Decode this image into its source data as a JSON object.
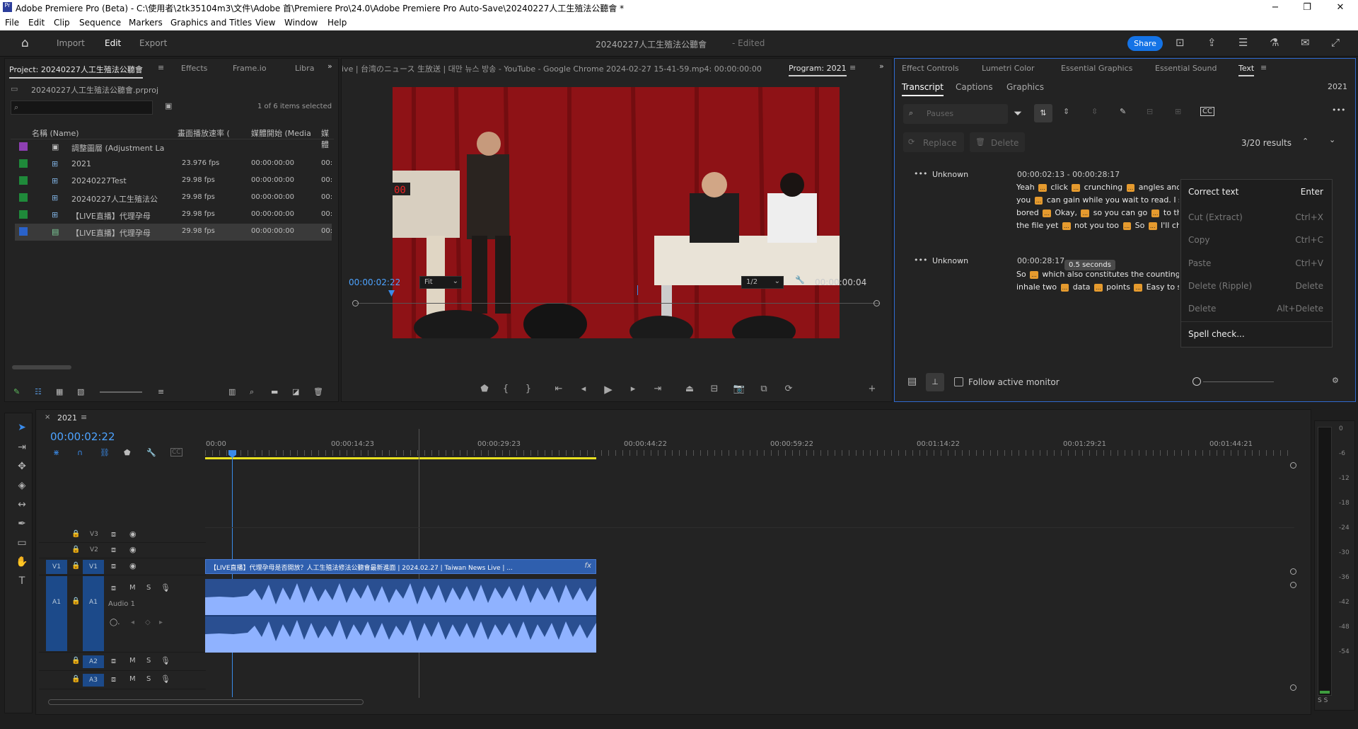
{
  "window": {
    "title": "Adobe Premiere Pro (Beta) - C:\\使用者\\2tk35104m3\\文件\\Adobe 首\\Premiere Pro\\24.0\\Adobe Premiere Pro Auto-Save\\20240227人工生殖法公聽會 *",
    "min": "−",
    "max": "❐",
    "close": "✕"
  },
  "menu": [
    "File",
    "Edit",
    "Clip",
    "Sequence",
    "Markers",
    "Graphics and Titles",
    "View",
    "Window",
    "Help"
  ],
  "appbar": {
    "workspaces": [
      "Import",
      "Edit",
      "Export"
    ],
    "active_workspace": "Edit",
    "project_title": "20240227人工生殖法公聽會",
    "edited": "- Edited",
    "share": "Share"
  },
  "project_panel": {
    "tabs": [
      "Project: 20240227人工生殖法公聽會",
      "Effects",
      "Frame.io",
      "Libra"
    ],
    "file": "20240227人工生殖法公聽會.prproj",
    "selection": "1 of 6 items selected",
    "columns": [
      "名稱 (Name)",
      "畫面播放速率 (",
      "媒體開始 (Media",
      "媒體"
    ],
    "rows": [
      {
        "name": "調整圖層 (Adjustment La",
        "fps": "",
        "start": "",
        "end": "",
        "color": "#8e3fb3"
      },
      {
        "name": "2021",
        "fps": "23.976 fps",
        "start": "00:00:00:00",
        "end": "00:",
        "color": "#1f8a3a"
      },
      {
        "name": "20240227Test",
        "fps": "29.98 fps",
        "start": "00:00:00:00",
        "end": "00:",
        "color": "#1f8a3a"
      },
      {
        "name": "20240227人工生殖法公",
        "fps": "29.98 fps",
        "start": "00:00:00:00",
        "end": "00:",
        "color": "#1f8a3a"
      },
      {
        "name": "【LIVE直播】代理孕母",
        "fps": "29.98 fps",
        "start": "00:00:00:00",
        "end": "00:",
        "color": "#1f8a3a"
      },
      {
        "name": "【LIVE直播】代理孕母",
        "fps": "29.98 fps",
        "start": "00:00:00:00",
        "end": "00:",
        "color": "#2a62c9"
      }
    ]
  },
  "program_monitor": {
    "source_label": "ive | 台湾のニュース 生放送 | 대만 뉴스 방송 - YouTube - Google Chrome 2024-02-27 15-41-59.mp4: 00:00:00:00",
    "tab": "Program: 2021",
    "timecode": "00:00:02:22",
    "fit": "Fit",
    "res": "1/2",
    "duration": "00:00:00:04",
    "scoreboard": "00"
  },
  "text_panel": {
    "tabs": [
      "Effect Controls",
      "Lumetri Color",
      "Essential Graphics",
      "Essential Sound",
      "Text"
    ],
    "subtabs": [
      "Transcript",
      "Captions",
      "Graphics"
    ],
    "sequence": "2021",
    "search_placeholder": "Pauses",
    "replace": "Replace",
    "delete": "Delete",
    "results": "3/20 results",
    "follow": "Follow active monitor",
    "tooltip": "0.5 seconds",
    "segments": [
      {
        "speaker": "Unknown",
        "time": "00:00:02:13 - 00:00:28:17",
        "lines": [
          "Yeah [..] click [..] crunching [..] angles and divi",
          "you [..] can gain while you wait to read. I sense h",
          "bored [..] Okay, [..] so you can go [..] to that [..]",
          "the file yet [..] not you too [..] So [..] I'll choose"
        ]
      },
      {
        "speaker": "Unknown",
        "time": "00:00:28:17",
        "lines": [
          "So [..] which also constitutes the counting home",
          "inhale two [..] data [..] points [..] Easy to see n"
        ]
      }
    ]
  },
  "context_menu": [
    {
      "label": "Correct text",
      "key": "Enter",
      "enabled": true
    },
    {
      "label": "Cut (Extract)",
      "key": "Ctrl+X",
      "enabled": false
    },
    {
      "label": "Copy",
      "key": "Ctrl+C",
      "enabled": false
    },
    {
      "label": "Paste",
      "key": "Ctrl+V",
      "enabled": false
    },
    {
      "label": "Delete (Ripple)",
      "key": "Delete",
      "enabled": false
    },
    {
      "label": "Delete",
      "key": "Alt+Delete",
      "enabled": false
    },
    {
      "label": "Spell check...",
      "key": "",
      "enabled": true
    }
  ],
  "timeline": {
    "tab": "2021",
    "timecode": "00:00:02:22",
    "ruler": [
      "00:00",
      "00:00:14:23",
      "00:00:29:23",
      "00:00:44:22",
      "00:00:59:22",
      "00:01:14:22",
      "00:01:29:21",
      "00:01:44:21"
    ],
    "tracks_video": [
      "V3",
      "V2",
      "V1"
    ],
    "tracks_audio": [
      "A1",
      "A2",
      "A3"
    ],
    "audio_name": "Audio 1",
    "clip_title": "【LIVE直播】代理孕母是否開放？人工生殖法修法公聽會最新進面 | 2024.02.27 | Taiwan News Live | ...",
    "meter_labels": [
      "0",
      "-6",
      "-12",
      "-18",
      "-24",
      "-30",
      "-36",
      "-42",
      "-48",
      "-54"
    ],
    "meter_bottom": "S S",
    "clip_fx": "fx"
  }
}
